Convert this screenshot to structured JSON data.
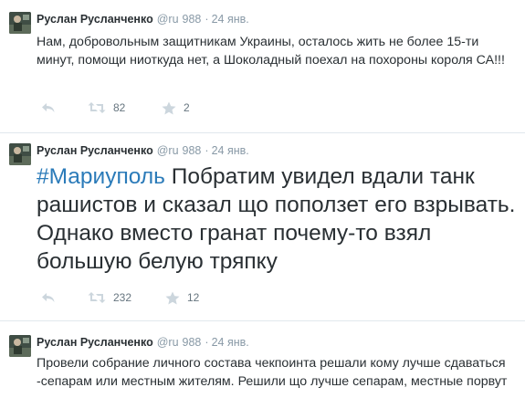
{
  "tweets": [
    {
      "author": "Руслан Русланченко",
      "handle": "@ru",
      "followers": "988",
      "dot": "·",
      "time": "24 янв.",
      "text": "Нам, добровольным защитникам Украины, осталось жить не более 15-ти минут, помощи ниоткуда нет, а Шоколадный поехал на похороны короля СА!!!",
      "retweets": "82",
      "favorites": "2"
    },
    {
      "author": "Руслан Русланченко",
      "handle": "@ru",
      "followers": "988",
      "dot": "·",
      "time": "24 янв.",
      "hashtag": "#Мариуполь",
      "text": " Побратим увидел вдали танк рашистов и сказал що поползет его взрывать. Однако вместо гранат почему-то взял большую белую тряпку",
      "retweets": "232",
      "favorites": "12"
    },
    {
      "author": "Руслан Русланченко",
      "handle": "@ru",
      "followers": "988",
      "dot": "·",
      "time": "24 янв.",
      "text": "Провели собрание личного состава чекпоинта решали кому лучше сдаваться -сепарам или местным жителям. Решили що лучше сепарам, местные порвут"
    }
  ],
  "icons": {
    "reply": "reply-icon",
    "retweet": "retweet-icon",
    "favorite": "star-icon"
  },
  "colors": {
    "text": "#292f33",
    "meta": "#8899a6",
    "hashtag": "#2b7bb9",
    "icon": "#ccd6dd",
    "divider": "#e1e8ed"
  }
}
